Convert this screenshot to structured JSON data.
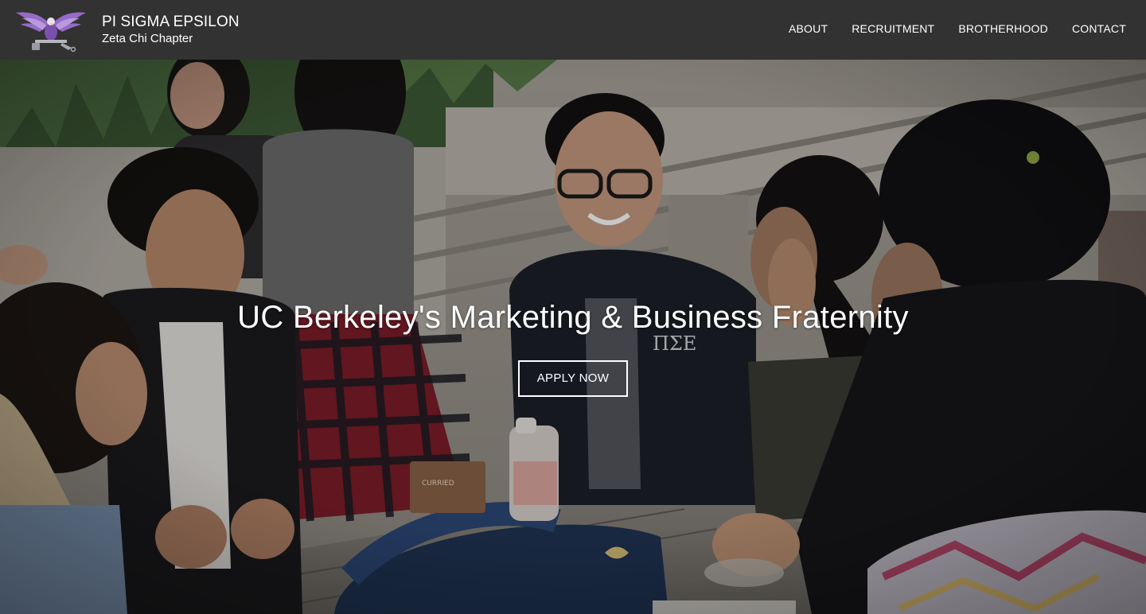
{
  "brand": {
    "title": "PI SIGMA EPSILON",
    "subtitle": "Zeta Chi Chapter",
    "logo_icon": "eagle-crest-icon"
  },
  "nav": {
    "items": [
      {
        "label": "ABOUT"
      },
      {
        "label": "RECRUITMENT"
      },
      {
        "label": "BROTHERHOOD"
      },
      {
        "label": "CONTACT"
      }
    ]
  },
  "hero": {
    "heading": "UC Berkeley's Marketing & Business Fraternity",
    "cta_label": "APPLY NOW",
    "photo_subject": "students-at-outdoor-table-photo"
  },
  "colors": {
    "navbar_bg": "#323232",
    "text": "#ffffff",
    "logo_purple": "#8a5fb8"
  }
}
